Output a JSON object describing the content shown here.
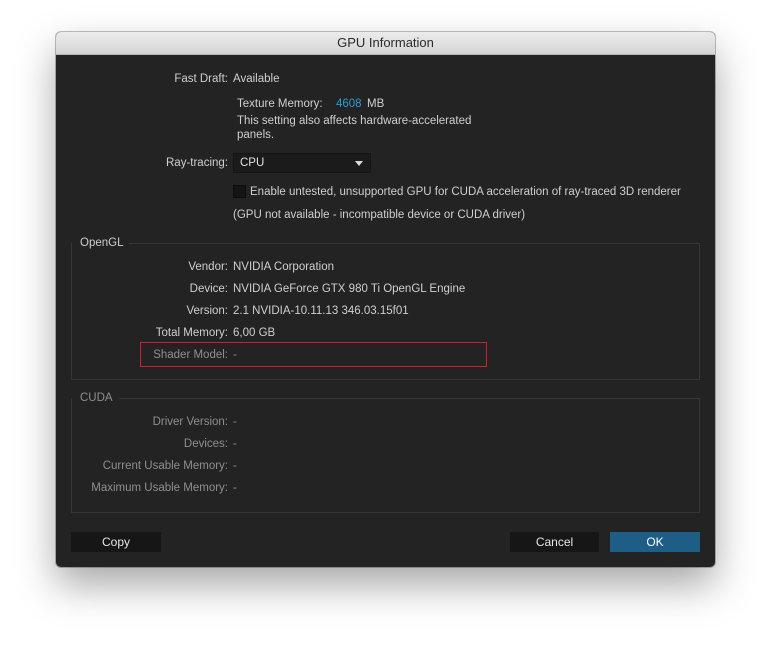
{
  "window": {
    "title": "GPU Information"
  },
  "general": {
    "fast_draft_label": "Fast Draft:",
    "fast_draft_value": "Available",
    "texture_memory_label": "Texture Memory:",
    "texture_memory_value": "4608",
    "texture_memory_unit": "MB",
    "texture_note_line1": "This setting also affects hardware-accelerated",
    "texture_note_line2": "panels.",
    "ray_tracing_label": "Ray-tracing:",
    "ray_tracing_selected": "CPU",
    "untested_gpu_checkbox_label": "Enable untested, unsupported GPU for CUDA acceleration of ray-traced 3D renderer",
    "untested_gpu_checked": false,
    "gpu_status_note": "(GPU not available - incompatible device or CUDA driver)"
  },
  "opengl": {
    "title": "OpenGL",
    "rows": [
      {
        "label": "Vendor:",
        "value": "NVIDIA Corporation"
      },
      {
        "label": "Device:",
        "value": "NVIDIA GeForce GTX 980 Ti OpenGL Engine"
      },
      {
        "label": "Version:",
        "value": "2.1 NVIDIA-10.11.13 346.03.15f01"
      },
      {
        "label": "Total Memory:",
        "value": "6,00 GB"
      },
      {
        "label": "Shader Model:",
        "value": "-"
      }
    ]
  },
  "cuda": {
    "title": "CUDA",
    "rows": [
      {
        "label": "Driver Version:",
        "value": "-"
      },
      {
        "label": "Devices:",
        "value": "-"
      },
      {
        "label": "Current Usable Memory:",
        "value": "-"
      },
      {
        "label": "Maximum Usable Memory:",
        "value": "-"
      }
    ]
  },
  "buttons": {
    "copy": "Copy",
    "cancel": "Cancel",
    "ok": "OK"
  },
  "colors": {
    "accent": "#2d9ad3",
    "highlight": "#d01f2e",
    "ok_button": "#1d5d86"
  }
}
